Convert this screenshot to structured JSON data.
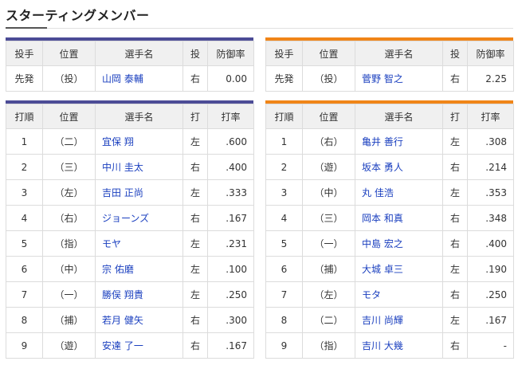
{
  "title": "スターティングメンバー",
  "colors": {
    "left_accent": "#4c4c96",
    "right_accent": "#f08518",
    "name_link": "#1a3fbf"
  },
  "pitcher_headers": [
    "投手",
    "位置",
    "選手名",
    "投",
    "防御率"
  ],
  "batter_headers": [
    "打順",
    "位置",
    "選手名",
    "打",
    "打率"
  ],
  "left": {
    "pitcher": {
      "role": "先発",
      "pos": "（投）",
      "name": "山岡 泰輔",
      "hand": "右",
      "era": "0.00"
    },
    "batters": [
      {
        "order": "1",
        "pos": "（二）",
        "name": "宜保 翔",
        "hand": "左",
        "avg": ".600"
      },
      {
        "order": "2",
        "pos": "（三）",
        "name": "中川 圭太",
        "hand": "右",
        "avg": ".400"
      },
      {
        "order": "3",
        "pos": "（左）",
        "name": "吉田 正尚",
        "hand": "左",
        "avg": ".333"
      },
      {
        "order": "4",
        "pos": "（右）",
        "name": "ジョーンズ",
        "hand": "右",
        "avg": ".167"
      },
      {
        "order": "5",
        "pos": "（指）",
        "name": "モヤ",
        "hand": "左",
        "avg": ".231"
      },
      {
        "order": "6",
        "pos": "（中）",
        "name": "宗 佑磨",
        "hand": "左",
        "avg": ".100"
      },
      {
        "order": "7",
        "pos": "（一）",
        "name": "勝俣 翔貴",
        "hand": "左",
        "avg": ".250"
      },
      {
        "order": "8",
        "pos": "（捕）",
        "name": "若月 健矢",
        "hand": "右",
        "avg": ".300"
      },
      {
        "order": "9",
        "pos": "（遊）",
        "name": "安達 了一",
        "hand": "右",
        "avg": ".167"
      }
    ]
  },
  "right": {
    "pitcher": {
      "role": "先発",
      "pos": "（投）",
      "name": "菅野 智之",
      "hand": "右",
      "era": "2.25"
    },
    "batters": [
      {
        "order": "1",
        "pos": "（右）",
        "name": "亀井 善行",
        "hand": "左",
        "avg": ".308"
      },
      {
        "order": "2",
        "pos": "（遊）",
        "name": "坂本 勇人",
        "hand": "右",
        "avg": ".214"
      },
      {
        "order": "3",
        "pos": "（中）",
        "name": "丸 佳浩",
        "hand": "左",
        "avg": ".353"
      },
      {
        "order": "4",
        "pos": "（三）",
        "name": "岡本 和真",
        "hand": "右",
        "avg": ".348"
      },
      {
        "order": "5",
        "pos": "（一）",
        "name": "中島 宏之",
        "hand": "右",
        "avg": ".400"
      },
      {
        "order": "6",
        "pos": "（捕）",
        "name": "大城 卓三",
        "hand": "左",
        "avg": ".190"
      },
      {
        "order": "7",
        "pos": "（左）",
        "name": "モタ",
        "hand": "右",
        "avg": ".250"
      },
      {
        "order": "8",
        "pos": "（二）",
        "name": "吉川 尚輝",
        "hand": "左",
        "avg": ".167"
      },
      {
        "order": "9",
        "pos": "（指）",
        "name": "吉川 大幾",
        "hand": "右",
        "avg": "-"
      }
    ]
  }
}
